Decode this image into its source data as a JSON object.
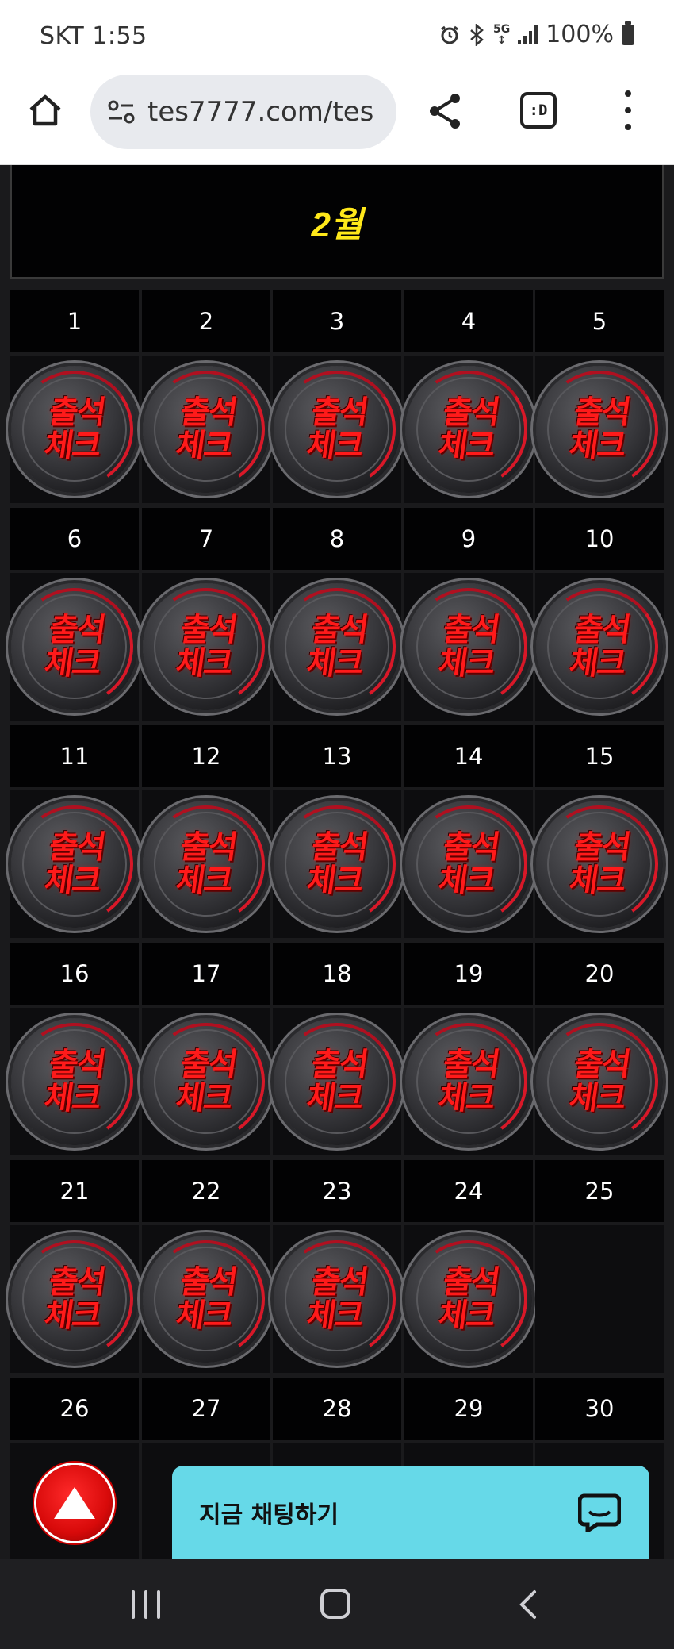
{
  "status_bar": {
    "carrier_time": "SKT 1:55",
    "network": "5G",
    "battery": "100%",
    "icons": [
      "alarm-icon",
      "bluetooth-icon",
      "5g-icon",
      "signal-icon",
      "battery-icon"
    ]
  },
  "browser": {
    "url": "tes7777.com/tes",
    "tab_label": ":D",
    "icons": [
      "home-icon",
      "site-settings-icon",
      "share-icon",
      "tab-switcher-icon",
      "more-menu-icon"
    ]
  },
  "calendar": {
    "month_title": "2월",
    "stamp_text_line1": "출석",
    "stamp_text_line2": "체크",
    "weeks": [
      {
        "days": [
          {
            "num": "1",
            "checked": true
          },
          {
            "num": "2",
            "checked": true
          },
          {
            "num": "3",
            "checked": true
          },
          {
            "num": "4",
            "checked": true
          },
          {
            "num": "5",
            "checked": true
          }
        ]
      },
      {
        "days": [
          {
            "num": "6",
            "checked": true
          },
          {
            "num": "7",
            "checked": true
          },
          {
            "num": "8",
            "checked": true
          },
          {
            "num": "9",
            "checked": true
          },
          {
            "num": "10",
            "checked": true
          }
        ]
      },
      {
        "days": [
          {
            "num": "11",
            "checked": true
          },
          {
            "num": "12",
            "checked": true
          },
          {
            "num": "13",
            "checked": true
          },
          {
            "num": "14",
            "checked": true
          },
          {
            "num": "15",
            "checked": true
          }
        ]
      },
      {
        "days": [
          {
            "num": "16",
            "checked": true
          },
          {
            "num": "17",
            "checked": true
          },
          {
            "num": "18",
            "checked": true
          },
          {
            "num": "19",
            "checked": true
          },
          {
            "num": "20",
            "checked": true
          }
        ]
      },
      {
        "days": [
          {
            "num": "21",
            "checked": true
          },
          {
            "num": "22",
            "checked": true
          },
          {
            "num": "23",
            "checked": true
          },
          {
            "num": "24",
            "checked": true
          },
          {
            "num": "25",
            "checked": false
          }
        ]
      },
      {
        "days": [
          {
            "num": "26",
            "checked": false
          },
          {
            "num": "27",
            "checked": false
          },
          {
            "num": "28",
            "checked": false
          },
          {
            "num": "29",
            "checked": false
          },
          {
            "num": "30",
            "checked": false
          }
        ]
      }
    ]
  },
  "floating": {
    "chat_label": "지금 채팅하기",
    "scroll_top_icon": "arrow-up-icon",
    "chat_icon": "chat-bubble-icon"
  },
  "colors": {
    "month_title": "#ffe81a",
    "stamp_text": "#ff1a1a",
    "chat_bar": "#66d9e8",
    "scroll_top_button": "#d80a0a"
  },
  "nav_bar": {
    "icons": [
      "recent-apps-icon",
      "home-button-icon",
      "back-icon"
    ]
  }
}
